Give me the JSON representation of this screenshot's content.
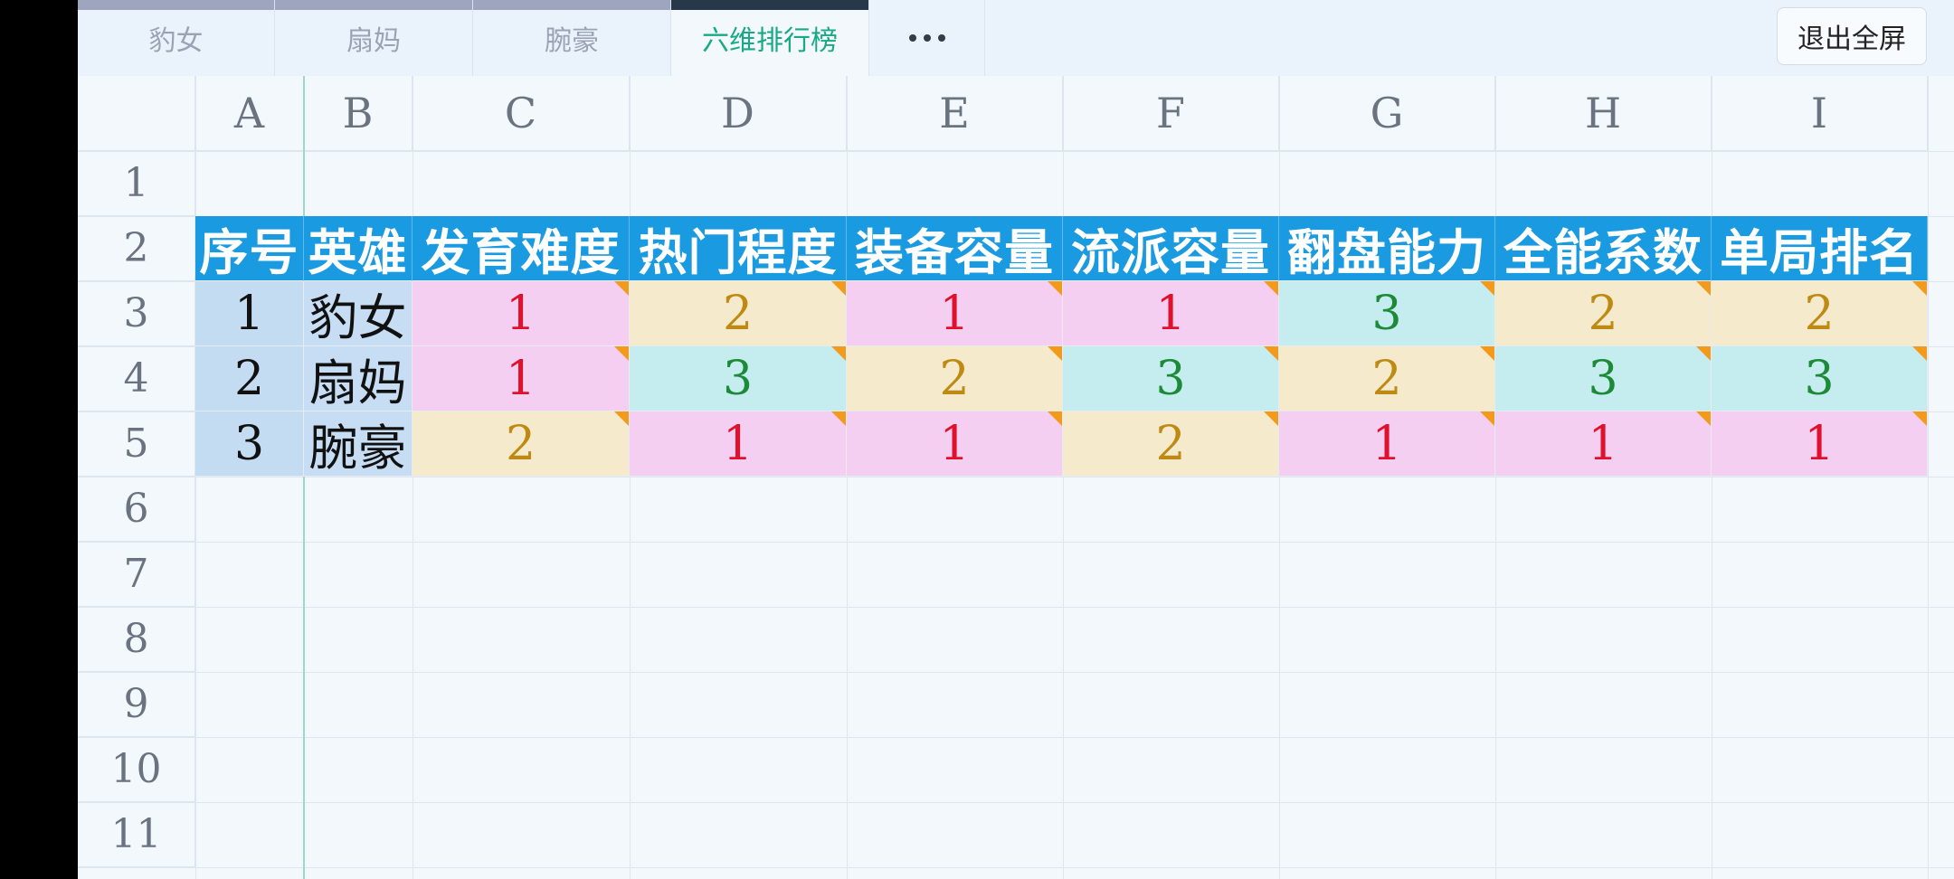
{
  "tabs": [
    {
      "label": "豹女",
      "active": false
    },
    {
      "label": "扇妈",
      "active": false
    },
    {
      "label": "腕豪",
      "active": false
    },
    {
      "label": "六维排行榜",
      "active": true
    }
  ],
  "more_icon": "more-horizontal-icon",
  "exit_fullscreen_label": "退出全屏",
  "column_letters": [
    "A",
    "B",
    "C",
    "D",
    "E",
    "F",
    "G",
    "H",
    "I"
  ],
  "row_numbers": [
    "1",
    "2",
    "3",
    "4",
    "5",
    "6",
    "7",
    "8",
    "9",
    "10",
    "11"
  ],
  "table": {
    "headers": [
      "序号",
      "英雄",
      "发育难度",
      "热门程度",
      "装备容量",
      "流派容量",
      "翻盘能力",
      "全能系数",
      "单局排名"
    ],
    "rows": [
      {
        "index": "1",
        "hero": "豹女",
        "values": [
          "1",
          "2",
          "1",
          "1",
          "3",
          "2",
          "2"
        ]
      },
      {
        "index": "2",
        "hero": "扇妈",
        "values": [
          "1",
          "3",
          "2",
          "3",
          "2",
          "3",
          "3"
        ]
      },
      {
        "index": "3",
        "hero": "腕豪",
        "values": [
          "2",
          "1",
          "1",
          "2",
          "1",
          "1",
          "1"
        ]
      }
    ]
  },
  "colors": {
    "header_bg": "#1a9ae0",
    "value_1": "#e0112c",
    "value_2": "#bf8a14",
    "value_3": "#1c8a37",
    "active_tab": "#1aa985",
    "comment_marker": "#f39a1a"
  }
}
